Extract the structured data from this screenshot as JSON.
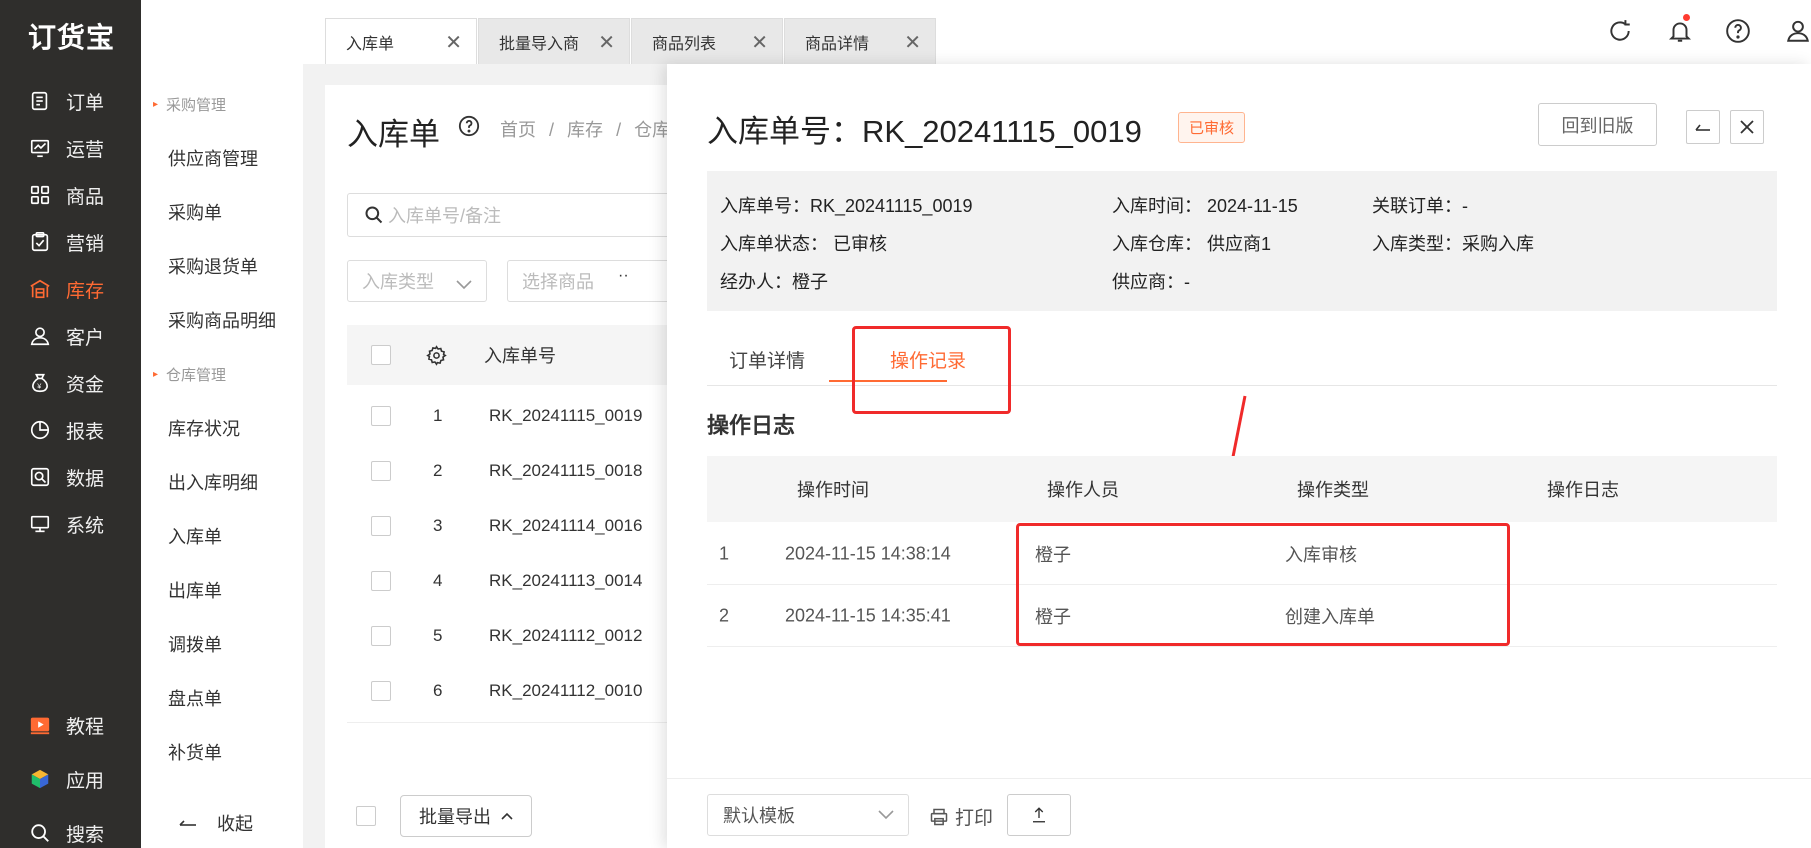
{
  "brand": {
    "logo": "订货宝"
  },
  "sidebar": {
    "items": [
      {
        "label": "订单",
        "icon": "order-icon"
      },
      {
        "label": "运营",
        "icon": "operation-icon"
      },
      {
        "label": "商品",
        "icon": "goods-icon"
      },
      {
        "label": "营销",
        "icon": "marketing-icon"
      },
      {
        "label": "库存",
        "icon": "warehouse-icon",
        "active": true
      },
      {
        "label": "客户",
        "icon": "customer-icon"
      },
      {
        "label": "资金",
        "icon": "funds-icon"
      },
      {
        "label": "报表",
        "icon": "report-icon"
      },
      {
        "label": "数据",
        "icon": "data-icon"
      },
      {
        "label": "系统",
        "icon": "system-icon"
      }
    ],
    "bottom_items": [
      {
        "label": "教程",
        "icon": "tutorial-icon"
      },
      {
        "label": "应用",
        "icon": "apps-icon"
      },
      {
        "label": "搜索",
        "icon": "search-icon"
      }
    ],
    "accent_color": "#ff6a33"
  },
  "submenu": {
    "group1": "采购管理",
    "group1_items": [
      "供应商管理",
      "采购单",
      "采购退货单",
      "采购商品明细"
    ],
    "group2": "仓库管理",
    "group2_items": [
      "库存状况",
      "出入库明细",
      "入库单",
      "出库单",
      "调拨单",
      "盘点单",
      "补货单"
    ],
    "collapse_label": "收起"
  },
  "tabs": [
    {
      "label": "入库单",
      "active": true
    },
    {
      "label": "批量导入商",
      "active": false
    },
    {
      "label": "商品列表",
      "active": false
    },
    {
      "label": "商品详情",
      "active": false
    }
  ],
  "list_page": {
    "title": "入库单",
    "breadcrumb": [
      "首页",
      "/",
      "库存",
      "/",
      "仓库"
    ],
    "search_placeholder": "入库单号/备注",
    "filter_type_placeholder": "入库类型",
    "filter_goods_placeholder": "选择商品",
    "col_no": "入库单号",
    "rows": [
      {
        "idx": "1",
        "no": "RK_20241115_0019"
      },
      {
        "idx": "2",
        "no": "RK_20241115_0018"
      },
      {
        "idx": "3",
        "no": "RK_20241114_0016"
      },
      {
        "idx": "4",
        "no": "RK_20241113_0014"
      },
      {
        "idx": "5",
        "no": "RK_20241112_0012"
      },
      {
        "idx": "6",
        "no": "RK_20241112_0010"
      }
    ],
    "batch_export": "批量导出"
  },
  "detail": {
    "title": "入库单号：RK_20241115_0019",
    "status_tag": "已审核",
    "old_version_btn": "回到旧版",
    "info": {
      "no": "入库单号：RK_20241115_0019",
      "time": "入库时间：  2024-11-15",
      "related": "关联订单：-",
      "state": "入库单状态：  已审核",
      "warehouse": "入库仓库：  供应商1",
      "type": "入库类型：采购入库",
      "handler": "经办人：橙子",
      "supplier": "供应商：-"
    },
    "tabs": [
      "订单详情",
      "操作记录"
    ],
    "active_tab": 1,
    "log_section_title": "操作日志",
    "log_headers": [
      "操作时间",
      "操作人员",
      "操作类型",
      "操作日志"
    ],
    "log_rows": [
      {
        "idx": "1",
        "time": "2024-11-15 14:38:14",
        "user": "橙子",
        "type": "入库审核",
        "log": ""
      },
      {
        "idx": "2",
        "time": "2024-11-15 14:35:41",
        "user": "橙子",
        "type": "创建入库单",
        "log": ""
      }
    ],
    "footer": {
      "template": "默认模板",
      "print": "打印"
    },
    "highlight_color": "#f02a2a"
  }
}
